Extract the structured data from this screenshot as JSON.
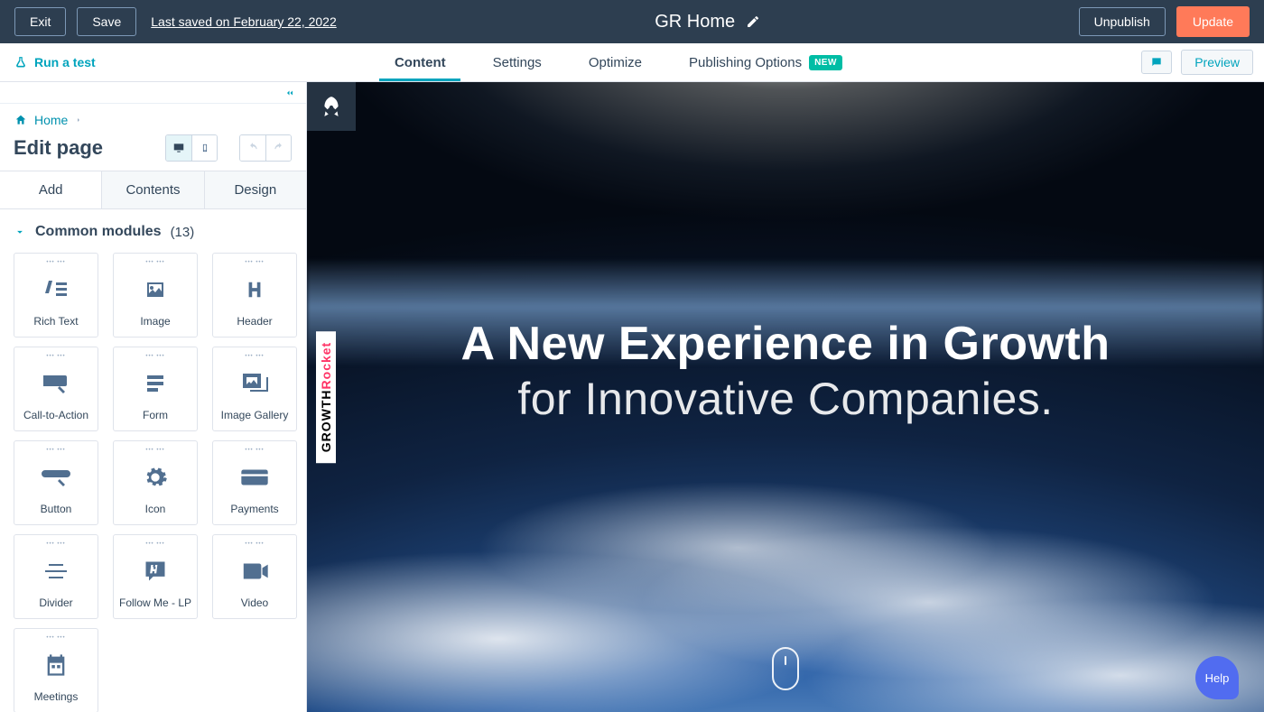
{
  "topbar": {
    "exit": "Exit",
    "save": "Save",
    "last_saved": "Last saved on February 22, 2022",
    "title": "GR Home",
    "unpublish": "Unpublish",
    "update": "Update"
  },
  "secondary": {
    "run_test": "Run a test",
    "tabs": {
      "content": "Content",
      "settings": "Settings",
      "optimize": "Optimize",
      "publishing": "Publishing Options",
      "new_badge": "NEW"
    },
    "preview": "Preview"
  },
  "sidebar": {
    "breadcrumb_home": "Home",
    "title": "Edit page",
    "tabs": {
      "add": "Add",
      "contents": "Contents",
      "design": "Design"
    },
    "section_title": "Common modules",
    "section_count": "(13)",
    "modules": {
      "rich_text": "Rich Text",
      "image": "Image",
      "header": "Header",
      "cta": "Call-to-Action",
      "form": "Form",
      "gallery": "Image Gallery",
      "button": "Button",
      "icon": "Icon",
      "payments": "Payments",
      "divider": "Divider",
      "follow": "Follow Me - LP",
      "video": "Video",
      "meetings": "Meetings"
    }
  },
  "canvas": {
    "line1": "A New Experience in Growth",
    "line2": "for Innovative Companies.",
    "brand1": "GROWTH",
    "brand2": "Rocket"
  },
  "help": {
    "label": "Help"
  }
}
